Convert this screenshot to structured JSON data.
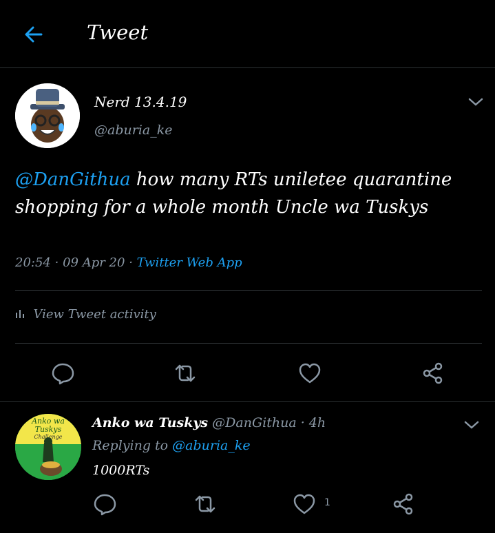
{
  "header": {
    "title": "Tweet"
  },
  "tweet": {
    "author_name": "Nerd 13.4.19",
    "author_handle": "@aburia_ke",
    "mention": "@DanGithua",
    "text": " how many RTs uniletee quarantine shopping for a whole month Uncle wa Tuskys",
    "time": "20:54",
    "date": "09 Apr 20",
    "source": "Twitter Web App",
    "activity_label": "View Tweet activity"
  },
  "reply": {
    "author_name": "Anko wa Tuskys",
    "author_handle": "@DanGithua",
    "age": "4h",
    "replying_to_label": "Replying to",
    "replying_to_handle": "@aburia_ke",
    "text": "1000RTs",
    "like_count": "1",
    "avatar_text_1": "Anko wa",
    "avatar_text_2": "Tuskys",
    "avatar_text_3": "Challenge"
  },
  "icons": [
    "back-arrow-icon",
    "chevron-down-icon",
    "reply-icon",
    "retweet-icon",
    "like-icon",
    "share-icon",
    "bar-chart-icon"
  ],
  "colors": {
    "accent": "#1da1f2",
    "muted": "#8b98a5",
    "divider": "#2f3336",
    "background": "#000000"
  }
}
